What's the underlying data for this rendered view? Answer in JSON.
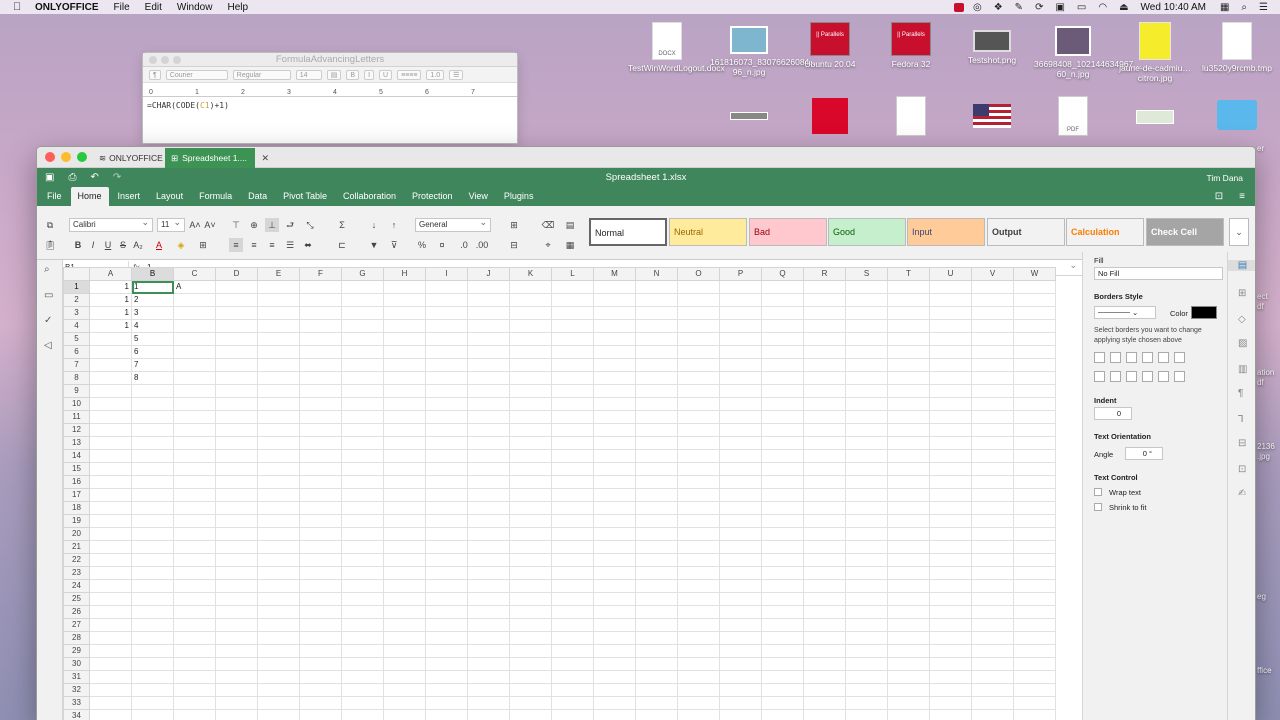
{
  "menubar": {
    "app": "ONLYOFFICE",
    "items": [
      "File",
      "Edit",
      "Window",
      "Help"
    ],
    "clock": "Wed 10:40 AM"
  },
  "desktop": {
    "icons": [
      {
        "label": "TestWinWordLogout.docx",
        "badge": "DOCX"
      },
      {
        "label": "161816073_83076626084…96_n.jpg"
      },
      {
        "label": "Ubuntu 20.04",
        "badge": "|| Parallels"
      },
      {
        "label": "Fedora 32",
        "badge": "|| Parallels"
      },
      {
        "label": "Testshot.png"
      },
      {
        "label": "36698408_102144634967…60_n.jpg"
      },
      {
        "label": "jaune-de-cadmiu…citron.jpg"
      },
      {
        "label": "lu3520y9rcmb.tmp"
      }
    ],
    "second_row": [
      {
        "badge": "PDF"
      }
    ],
    "edge_labels": [
      "er",
      "ect",
      "df",
      "ation",
      "df",
      "2136",
      ".jpg",
      "eg",
      "ffice"
    ]
  },
  "editor": {
    "title": "FormulaAdvancingLetters",
    "font": "Courier",
    "style": "Regular",
    "size": "14",
    "spacing": "1.0",
    "ruler": [
      "0",
      "1",
      "2",
      "3",
      "4",
      "5",
      "6",
      "7"
    ],
    "formula_parts": [
      "=CHAR(CODE(",
      "C1",
      ")+1)"
    ]
  },
  "onlyoffice": {
    "home_tab": "ONLYOFFICE",
    "doc_tab": "Spreadsheet 1....",
    "doc_title": "Spreadsheet 1.xlsx",
    "user": "Tim Dana",
    "menu_tabs": [
      "File",
      "Home",
      "Insert",
      "Layout",
      "Formula",
      "Data",
      "Pivot Table",
      "Collaboration",
      "Protection",
      "View",
      "Plugins"
    ],
    "active_tab": "Home",
    "toolbar": {
      "font_name": "Calibri",
      "font_size": "11",
      "number_format": "General"
    },
    "cell_styles": [
      {
        "name": "Normal",
        "bg": "#ffffff",
        "fg": "#222222",
        "bold": false
      },
      {
        "name": "Neutral",
        "bg": "#ffeb9c",
        "fg": "#9c6500",
        "bold": false
      },
      {
        "name": "Bad",
        "bg": "#ffc7ce",
        "fg": "#9c0006",
        "bold": false
      },
      {
        "name": "Good",
        "bg": "#c6efce",
        "fg": "#006100",
        "bold": false
      },
      {
        "name": "Input",
        "bg": "#ffcc99",
        "fg": "#3f3f76",
        "bold": false
      },
      {
        "name": "Output",
        "bg": "#f2f2f2",
        "fg": "#3f3f3f",
        "bold": true
      },
      {
        "name": "Calculation",
        "bg": "#f2f2f2",
        "fg": "#fa7d00",
        "bold": true
      },
      {
        "name": "Check Cell",
        "bg": "#a5a5a5",
        "fg": "#ffffff",
        "bold": true
      }
    ],
    "formula_bar": {
      "cell_ref": "B1",
      "fx": "fx",
      "value": "1"
    },
    "columns": [
      "A",
      "B",
      "C",
      "D",
      "E",
      "F",
      "G",
      "H",
      "I",
      "J",
      "K",
      "L",
      "M",
      "N",
      "O",
      "P",
      "Q",
      "R",
      "S",
      "T",
      "U",
      "V",
      "W"
    ],
    "row_count": 35,
    "cells": {
      "A": [
        "1",
        "1",
        "1",
        "1",
        "",
        "",
        "",
        ""
      ],
      "B": [
        "1",
        "2",
        "3",
        "4",
        "5",
        "6",
        "7",
        "8"
      ],
      "C": [
        "A",
        "",
        "",
        "",
        "",
        "",
        "",
        ""
      ]
    },
    "right_panel": {
      "fill_label": "Fill",
      "fill_value": "No Fill",
      "borders_label": "Borders Style",
      "color_label": "Color",
      "borders_hint": "Select borders you want to change applying style chosen above",
      "indent_label": "Indent",
      "indent_value": "0",
      "orientation_label": "Text Orientation",
      "angle_label": "Angle",
      "angle_value": "0 °",
      "text_control_label": "Text Control",
      "wrap_text": "Wrap text",
      "shrink_to_fit": "Shrink to fit"
    }
  }
}
